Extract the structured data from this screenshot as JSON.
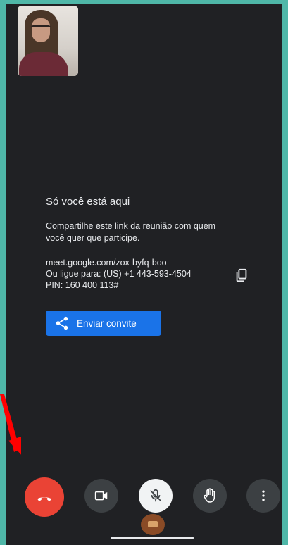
{
  "lobby": {
    "title": "Só você está aqui",
    "message": "Compartilhe este link da reunião com quem você quer que participe.",
    "meeting_link": "meet.google.com/zox-byfq-boo",
    "phone": "Ou ligue para: (US) +1 443-593-4504",
    "pin": "PIN: 160 400 113#",
    "invite_label": "Enviar convite"
  },
  "controls": {
    "end_call": "call-end-icon",
    "camera": "videocam-icon",
    "mic": "mic-off-icon",
    "raise_hand": "hand-icon",
    "more": "more-vert-icon"
  },
  "colors": {
    "background": "#202124",
    "frame": "#4fb7a8",
    "end_call": "#ea4335",
    "invite": "#1a73e8",
    "annotation_arrow": "#ff0000"
  }
}
